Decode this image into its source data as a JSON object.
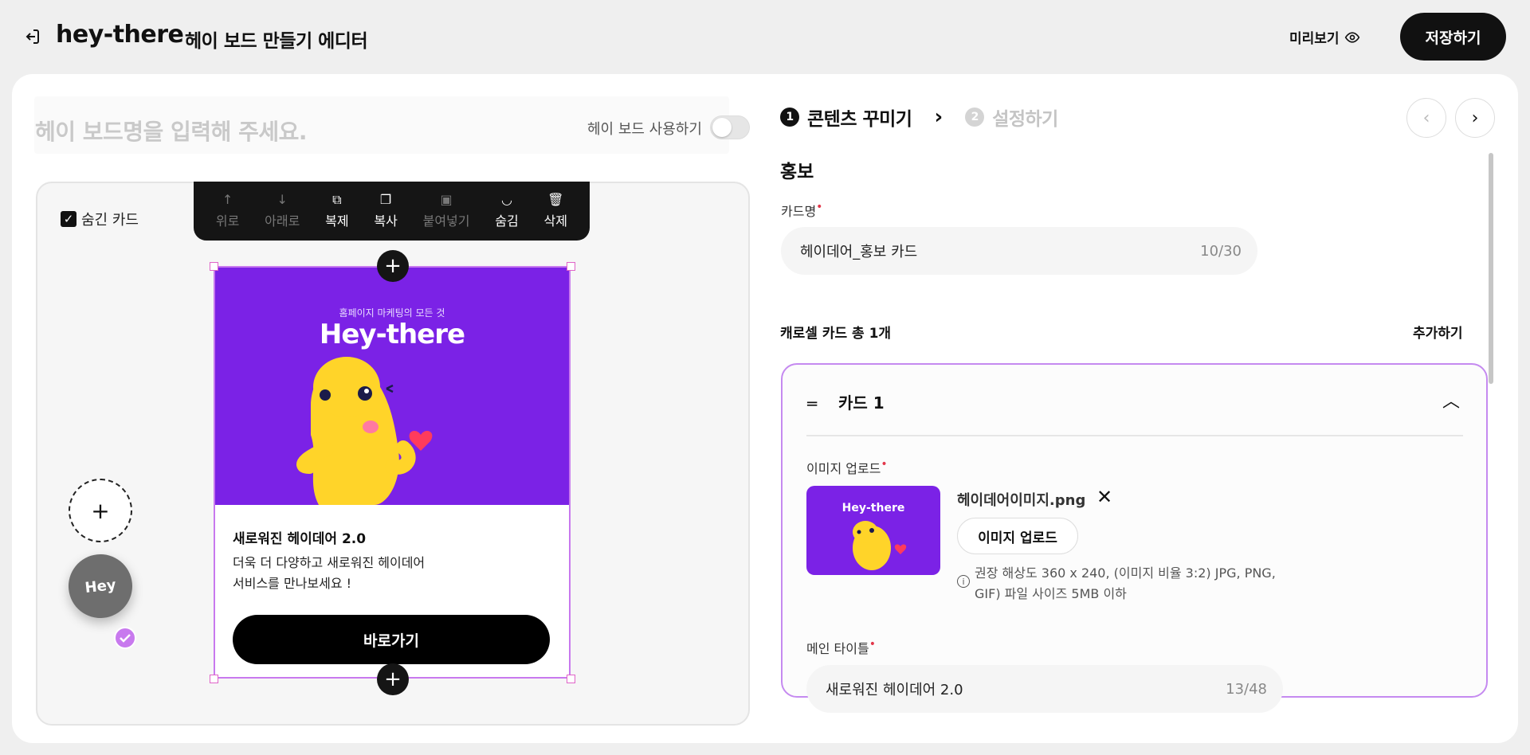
{
  "header": {
    "brand": "hey-there",
    "editor_title": "헤이 보드 만들기 에디터",
    "preview_label": "미리보기",
    "save_label": "저장하기"
  },
  "editor": {
    "board_name_placeholder": "헤이 보드명을 입력해 주세요.",
    "use_toggle_label": "헤이 보드 사용하기",
    "use_toggle_on": false,
    "hidden_card_label": "숨긴 카드",
    "hidden_card_checked": true,
    "toolbar": [
      {
        "icon": "arrow-up-icon",
        "label": "위로",
        "enabled": false
      },
      {
        "icon": "arrow-down-icon",
        "label": "아래로",
        "enabled": false
      },
      {
        "icon": "duplicate-icon",
        "label": "복제",
        "enabled": true
      },
      {
        "icon": "copy-icon",
        "label": "복사",
        "enabled": true
      },
      {
        "icon": "paste-icon",
        "label": "붙여넣기",
        "enabled": false
      },
      {
        "icon": "hide-icon",
        "label": "숨김",
        "enabled": true
      },
      {
        "icon": "trash-icon",
        "label": "삭제",
        "enabled": true
      }
    ],
    "card": {
      "image_subtitle": "홈페이지 마케팅의 모든 것",
      "image_title": "Hey-there",
      "title": "새로워진 헤이데어 2.0",
      "description_line1": "더욱 더 다양하고 새로워진 헤이데어",
      "description_line2": "서비스를 만나보세요 !",
      "cta_label": "바로가기",
      "accent_color": "#7b22e6"
    },
    "fab_label": "Hey"
  },
  "settings": {
    "steps": [
      {
        "num": "1",
        "label": "콘텐츠 꾸미기",
        "active": true
      },
      {
        "num": "2",
        "label": "설정하기",
        "active": false
      }
    ],
    "section_title": "홍보",
    "card_name_label": "카드명",
    "card_name_value": "헤이데어_홍보 카드",
    "card_name_counter": "10/30",
    "carousel_title": "캐로셀 카드 총 1개",
    "add_label": "추가하기",
    "card1": {
      "title": "카드 1",
      "image_upload_label": "이미지 업로드",
      "file_name": "헤이데어이미지.png",
      "upload_button": "이미지 업로드",
      "hint_line1": "권장 해상도 360 x 240, (이미지 비율 3:2) JPG, PNG,",
      "hint_line2": "GIF) 파일 사이즈 5MB 이하",
      "main_title_label": "메인 타이틀",
      "main_title_value": "새로워진 헤이데어 2.0",
      "main_title_counter": "13/48"
    }
  },
  "colors": {
    "primary": "#111111",
    "brand_purple": "#7b22e6",
    "selection": "#c879ee",
    "required": "#e2374a"
  }
}
